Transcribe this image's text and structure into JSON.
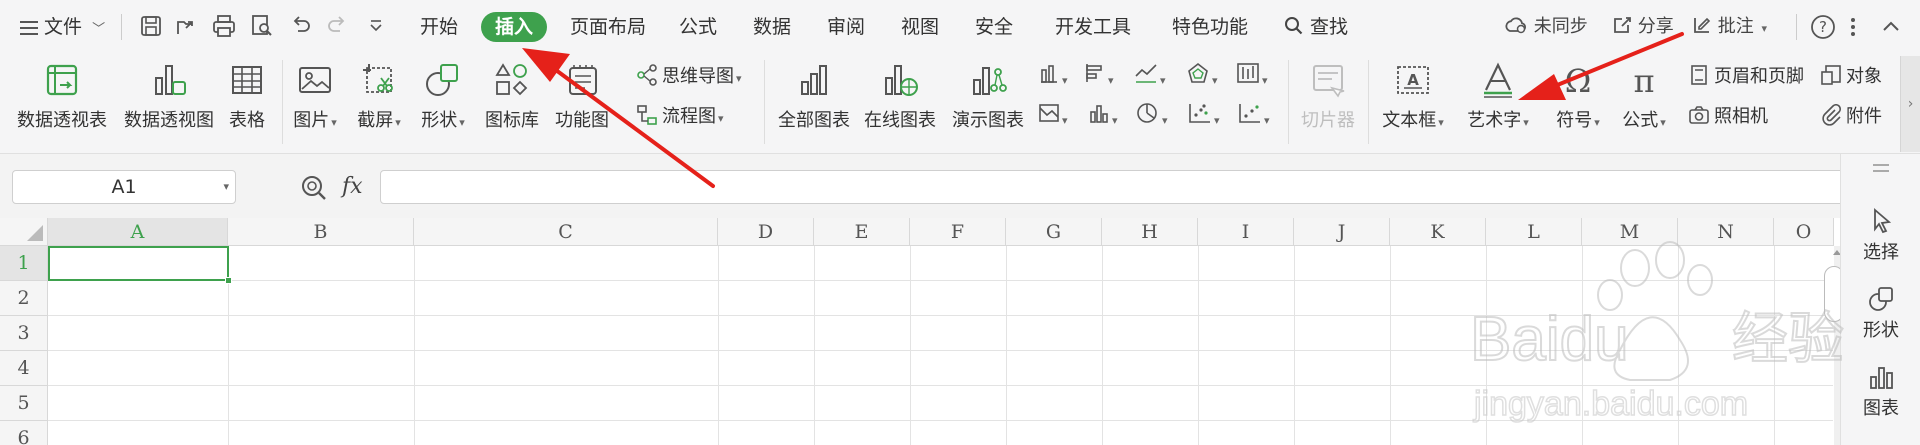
{
  "menu": {
    "file_label": "文件",
    "tabs": [
      {
        "label": "开始"
      },
      {
        "label": "插入",
        "active": true
      },
      {
        "label": "页面布局"
      },
      {
        "label": "公式"
      },
      {
        "label": "数据"
      },
      {
        "label": "审阅"
      },
      {
        "label": "视图"
      },
      {
        "label": "安全"
      },
      {
        "label": "开发工具"
      },
      {
        "label": "特色功能"
      }
    ],
    "search_label": "查找",
    "sync_label": "未同步",
    "share_label": "分享",
    "comment_label": "批注"
  },
  "ribbon": {
    "pivot_table": "数据透视表",
    "pivot_chart": "数据透视图",
    "table": "表格",
    "picture": "图片",
    "screenshot": "截屏",
    "shape": "形状",
    "icon_lib": "图标库",
    "func_chart": "功能图",
    "mind_map": "思维导图",
    "flowchart": "流程图",
    "all_charts": "全部图表",
    "online_chart": "在线图表",
    "demo_chart": "演示图表",
    "slicer": "切片器",
    "textbox": "文本框",
    "wordart": "艺术字",
    "symbol": "符号",
    "formula": "公式",
    "header_footer": "页眉和页脚",
    "object": "对象",
    "camera": "照相机",
    "attachment": "附件"
  },
  "formula_bar": {
    "name_box": "A1",
    "fx": "fx",
    "value": ""
  },
  "sheet": {
    "columns": [
      "A",
      "B",
      "C",
      "D",
      "E",
      "F",
      "G",
      "H",
      "I",
      "J",
      "K",
      "L",
      "M",
      "N",
      "O"
    ],
    "rows": [
      "1",
      "2",
      "3",
      "4",
      "5",
      "6"
    ],
    "selected_cell": "A1"
  },
  "side_panel": {
    "select": "选择",
    "shape": "形状",
    "chart": "图表"
  },
  "watermark": {
    "brand": "Baidu",
    "cn": "经验",
    "url": "jingyan.baidu.com"
  },
  "colors": {
    "accent": "#3ea14d",
    "arrow": "#e5211a"
  }
}
